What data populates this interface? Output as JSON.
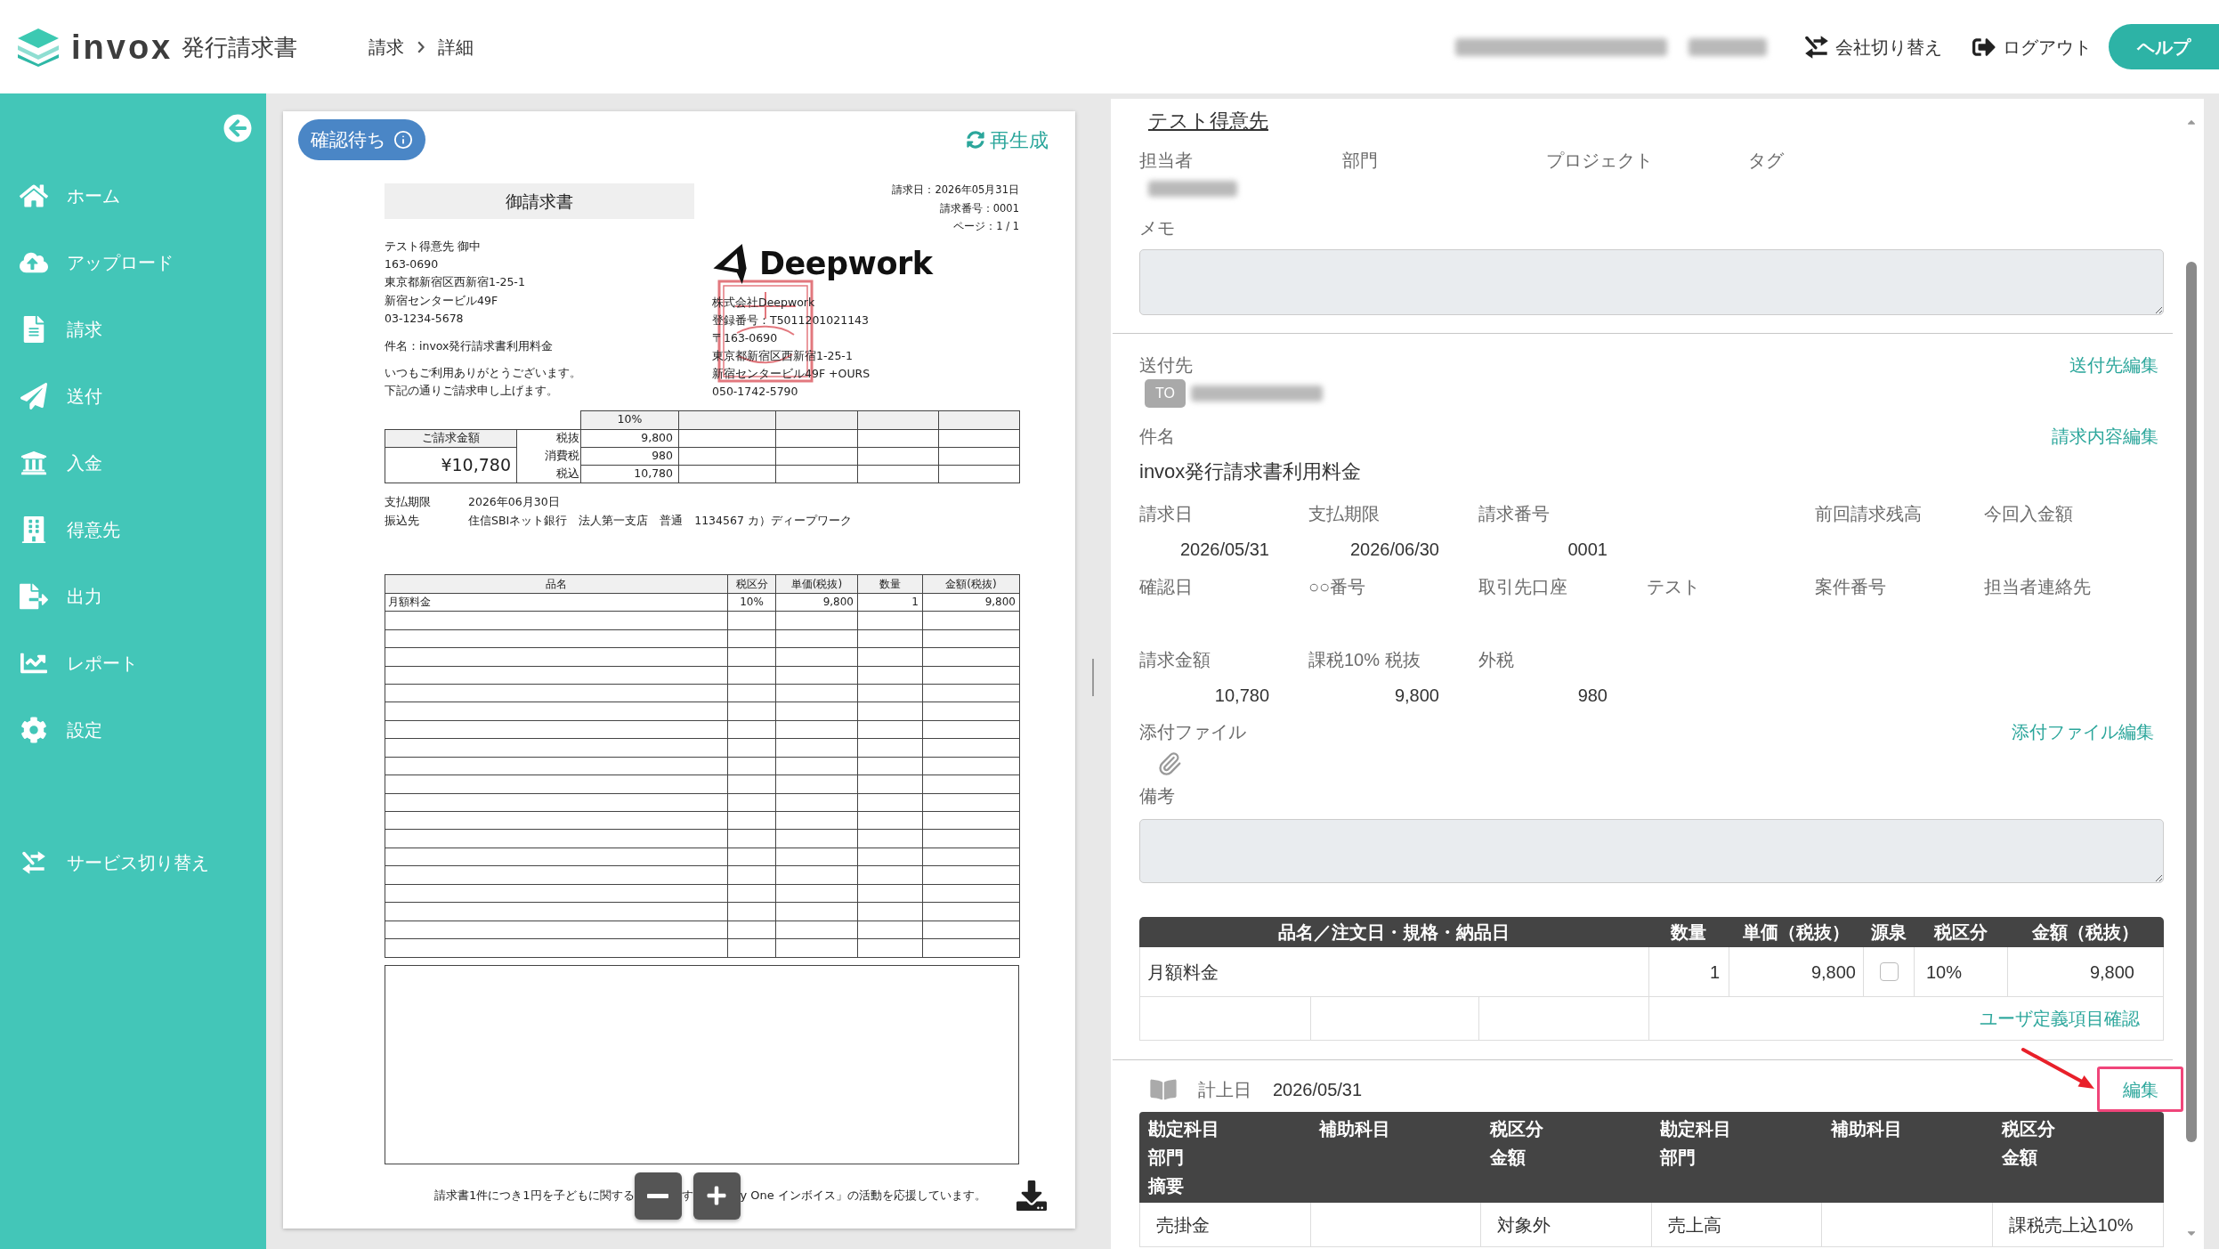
{
  "header": {
    "logo": "invox",
    "product": "発行請求書",
    "breadcrumb": [
      "請求",
      "詳細"
    ],
    "company_switch": "会社切り替え",
    "logout": "ログアウト",
    "help": "ヘルプ"
  },
  "sidebar": {
    "items": [
      {
        "label": "ホーム",
        "selected": false
      },
      {
        "label": "アップロード",
        "selected": false
      },
      {
        "label": "請求",
        "selected": false
      },
      {
        "label": "送付",
        "selected": false
      },
      {
        "label": "入金",
        "selected": false
      },
      {
        "label": "得意先",
        "selected": false
      },
      {
        "label": "出力",
        "selected": false
      },
      {
        "label": "レポート",
        "selected": false
      },
      {
        "label": "設定",
        "selected": false
      }
    ],
    "service_switch": "サービス切り替え"
  },
  "preview": {
    "status": "確認待ち",
    "regenerate": "再生成",
    "document": {
      "title": "御請求書",
      "meta": [
        "請求日：2026年05月31日",
        "請求番号：0001",
        "ページ：1 / 1"
      ],
      "recipient": [
        "テスト得意先 御中",
        "163-0690",
        "東京都新宿区西新宿1-25-1",
        "新宿センタービル49F",
        "03-1234-5678"
      ],
      "subject": "件名：invox発行請求書利用料金",
      "greeting": [
        "いつもご利用ありがとうございます。",
        "下記の通りご請求申し上げます。"
      ],
      "issuer_logo": "Deepwork",
      "issuer": [
        "株式会社Deepwork",
        "登録番号：T5011201021143",
        "〒163-0690",
        "東京都新宿区西新宿1-25-1",
        "新宿センタービル49F +OURS",
        "050-1742-5790"
      ],
      "summary": {
        "amount_label": "ご請求金額",
        "amount": "¥10,780",
        "rate": "10%",
        "rows": [
          {
            "label": "税抜",
            "value": "9,800"
          },
          {
            "label": "消費税",
            "value": "980"
          },
          {
            "label": "税込",
            "value": "10,780"
          }
        ]
      },
      "payment": [
        {
          "label": "支払期限",
          "value": "2026年06月30日"
        },
        {
          "label": "振込先",
          "value": "住信SBIネット銀行　法人第一支店　普通　1134567 カ）ディープワーク"
        }
      ],
      "items": {
        "columns": [
          "品名",
          "税区分",
          "単価(税抜)",
          "数量",
          "金額(税抜)"
        ],
        "rows": [
          [
            "月額料金",
            "10%",
            "9,800",
            "1",
            "9,800"
          ]
        ]
      },
      "footer": [
        "請求書1件につき1円を子どもに関する",
        "す",
        "y One インボイス」の活動を応援しています。"
      ]
    }
  },
  "detail": {
    "customer": "テスト得意先",
    "people_labels": [
      "担当者",
      "部門",
      "プロジェクト",
      "タグ"
    ],
    "memo_label": "メモ",
    "send_to": {
      "label": "送付先",
      "edit": "送付先編集",
      "badge": "TO"
    },
    "subject": {
      "label": "件名",
      "edit": "請求内容編集",
      "value": "invox発行請求書利用料金"
    },
    "fields": [
      [
        {
          "label": "請求日",
          "value": "2026/05/31"
        },
        {
          "label": "支払期限",
          "value": "2026/06/30"
        },
        {
          "label": "請求番号",
          "value": "0001"
        },
        {
          "label": "前回請求残高",
          "gap_before": true
        },
        {
          "label": "今回入金額"
        }
      ],
      [
        {
          "label": "確認日"
        },
        {
          "label": "○○番号"
        },
        {
          "label": "取引先口座"
        },
        {
          "label": "テスト"
        },
        {
          "label": "案件番号"
        },
        {
          "label": "担当者連絡先"
        }
      ],
      [
        {
          "label": "請求金額",
          "value": "10,780"
        },
        {
          "label": "課税10% 税抜",
          "value": "9,800"
        },
        {
          "label": "外税",
          "value": "980"
        }
      ]
    ],
    "attachments": {
      "label": "添付ファイル",
      "edit": "添付ファイル編集"
    },
    "remarks_label": "備考",
    "line_items": {
      "columns": [
        "品名／注文日・規格・納品日",
        "数量",
        "単価（税抜）",
        "源泉",
        "税区分",
        "金額（税抜）"
      ],
      "rows": [
        {
          "name": "月額料金",
          "quantity": "1",
          "unit_price": "9,800",
          "withholding": false,
          "tax": "10%",
          "amount": "9,800"
        }
      ],
      "custom_fields": "ユーザ定義項目確認"
    },
    "journal": {
      "date_label": "計上日",
      "date": "2026/05/31",
      "edit": {
        "label": "編集",
        "highlighted": true
      },
      "header_rows": [
        [
          "勘定科目",
          "補助科目",
          "税区分",
          "勘定科目",
          "補助科目",
          "税区分"
        ],
        [
          "部門",
          null,
          "金額",
          "部門",
          null,
          "金額"
        ],
        [
          "摘要"
        ]
      ],
      "rows": [
        [
          "売掛金",
          null,
          "対象外",
          "売上高",
          null,
          "課税売上込10%"
        ]
      ]
    }
  }
}
